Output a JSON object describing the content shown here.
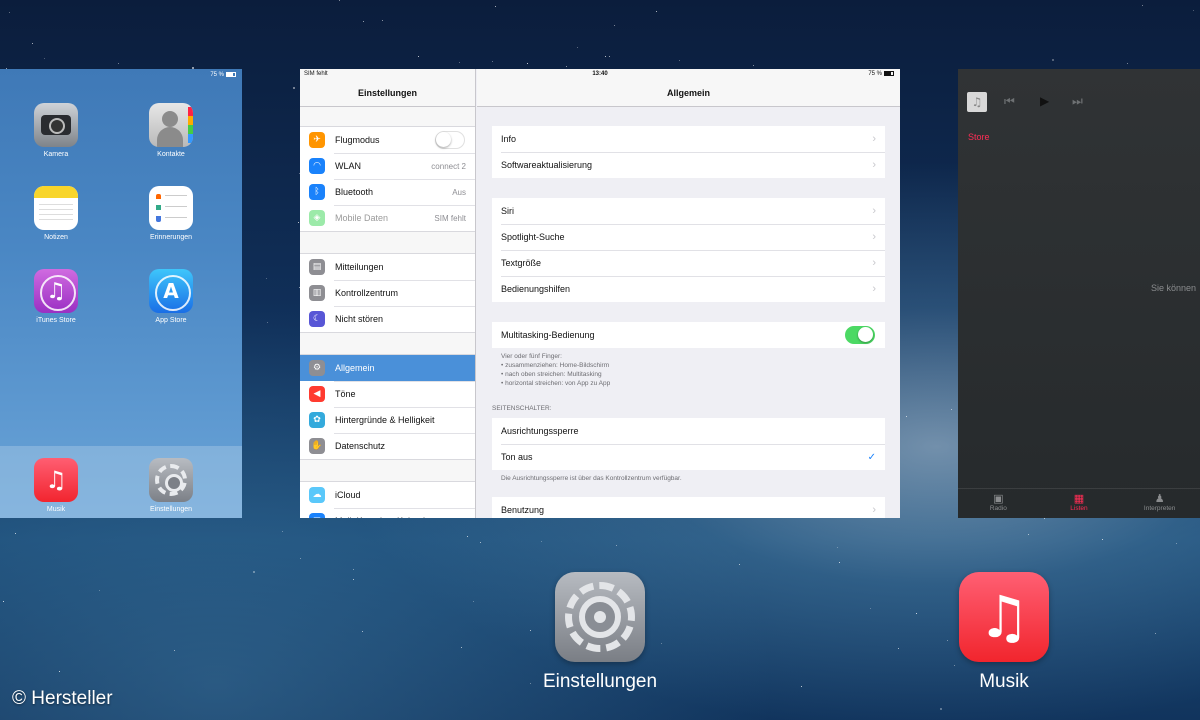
{
  "home_card": {
    "status_battery": "75 %",
    "apps": [
      {
        "label": "Kamera",
        "icon": "camera-icon"
      },
      {
        "label": "Kontakte",
        "icon": "contacts-icon"
      },
      {
        "label": "Notizen",
        "icon": "notes-icon"
      },
      {
        "label": "Erinnerungen",
        "icon": "reminders-icon"
      },
      {
        "label": "iTunes Store",
        "icon": "itunes-store-icon"
      },
      {
        "label": "App Store",
        "icon": "app-store-icon"
      }
    ],
    "dock": [
      {
        "label": "Musik",
        "icon": "music-icon"
      },
      {
        "label": "Einstellungen",
        "icon": "settings-icon"
      }
    ]
  },
  "settings_card": {
    "status": {
      "carrier": "SIM fehlt",
      "time": "13:40",
      "battery": "75 %"
    },
    "master_title": "Einstellungen",
    "master_groups": [
      [
        {
          "label": "Flugmodus",
          "icon": "airplane-icon",
          "color": "#ff9500",
          "switch": false
        },
        {
          "label": "WLAN",
          "icon": "wifi-icon",
          "color": "#1a82fb",
          "value": "connect 2"
        },
        {
          "label": "Bluetooth",
          "icon": "bluetooth-icon",
          "color": "#1a82fb",
          "value": "Aus"
        },
        {
          "label": "Mobile Daten",
          "icon": "antenna-icon",
          "color": "#4cd964",
          "value": "SIM fehlt",
          "disabled": true
        }
      ],
      [
        {
          "label": "Mitteilungen",
          "icon": "notifications-icon",
          "color": "#8e8e93"
        },
        {
          "label": "Kontrollzentrum",
          "icon": "control-center-icon",
          "color": "#8e8e93"
        },
        {
          "label": "Nicht stören",
          "icon": "moon-icon",
          "color": "#5856d6"
        }
      ],
      [
        {
          "label": "Allgemein",
          "icon": "gear-icon",
          "color": "#8e8e93",
          "selected": true
        },
        {
          "label": "Töne",
          "icon": "speaker-icon",
          "color": "#ff3b30"
        },
        {
          "label": "Hintergründe & Helligkeit",
          "icon": "flower-icon",
          "color": "#34aadc"
        },
        {
          "label": "Datenschutz",
          "icon": "hand-icon",
          "color": "#8e8e93"
        }
      ],
      [
        {
          "label": "iCloud",
          "icon": "cloud-icon",
          "color": "#5ac8fa"
        },
        {
          "label": "Mail, Kontakte, Kalender",
          "icon": "mail-icon",
          "color": "#1a82fb"
        }
      ]
    ],
    "detail_title": "Allgemein",
    "detail_groups": {
      "g1": [
        "Info",
        "Softwareaktualisierung"
      ],
      "g2": [
        "Siri",
        "Spotlight-Suche",
        "Textgröße",
        "Bedienungshilfen"
      ],
      "multitasking_label": "Multitasking-Bedienung",
      "multitasking_on": true,
      "multitasking_note": [
        "Vier oder fünf Finger:",
        "• zusammenziehen: Home-Bildschirm",
        "• nach oben streichen: Multitasking",
        "• horizontal streichen: von App zu App"
      ],
      "section_header": "SEITENSCHALTER:",
      "side_switch": [
        "Ausrichtungssperre",
        "Ton aus"
      ],
      "side_switch_note": "Die Ausrichtungssperre ist über das Kontrollzentrum verfügbar.",
      "usage": "Benutzung"
    }
  },
  "music_card": {
    "store_link": "Store",
    "message": "Sie können",
    "tabs": [
      {
        "label": "Radio",
        "icon": "radio-icon",
        "active": false
      },
      {
        "label": "Listen",
        "icon": "playlist-icon",
        "active": true
      },
      {
        "label": "Interpreten",
        "icon": "artist-icon",
        "active": false
      }
    ],
    "accent_color": "#ff2d55"
  },
  "switcher": {
    "apps": [
      {
        "label": "Einstellungen",
        "icon": "settings-icon"
      },
      {
        "label": "Musik",
        "icon": "music-icon"
      }
    ]
  },
  "credit": "© Hersteller"
}
